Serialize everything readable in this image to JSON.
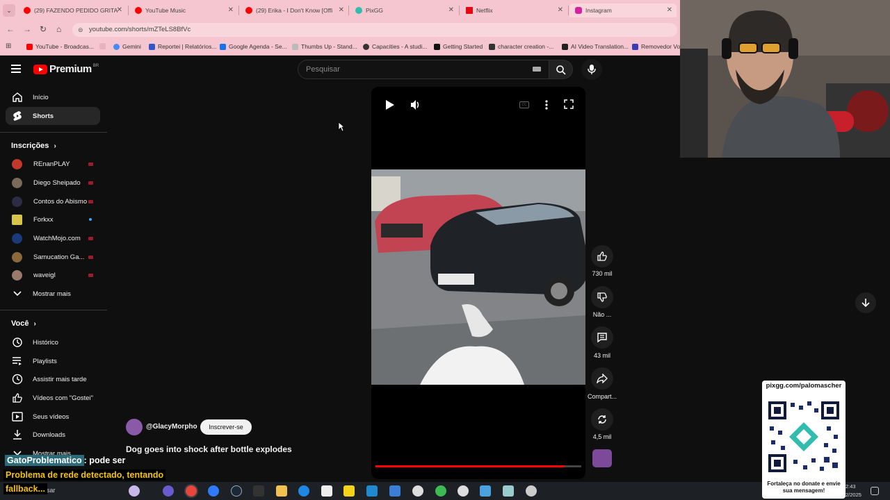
{
  "browser": {
    "tabs": [
      {
        "label": "(29) FAZENDO PEDIDO GRITA",
        "icon": "youtube-icon",
        "color": "#ff0000"
      },
      {
        "label": "YouTube Music",
        "icon": "youtube-music-icon",
        "color": "#ff0000"
      },
      {
        "label": "(29) Erika - I Don't Know [Offi",
        "icon": "youtube-icon",
        "color": "#ff0000"
      },
      {
        "label": "PixGG",
        "icon": "pixgg-icon",
        "color": "#32bcad"
      },
      {
        "label": "Netflix",
        "icon": "netflix-icon",
        "color": "#e50914"
      },
      {
        "label": "Instagram",
        "icon": "instagram-icon",
        "color": "#d6249f"
      }
    ],
    "url": "youtube.com/shorts/mZTeLS8BfVc",
    "bookmarks": [
      {
        "label": "YouTube - Broadcas...",
        "color": "#ff0000"
      },
      {
        "label": "Gemini",
        "color": "#4a8af4"
      },
      {
        "label": "Reportei | Relatórios...",
        "color": "#3355cc"
      },
      {
        "label": "Google Agenda - Se...",
        "color": "#1a73e8"
      },
      {
        "label": "Thumbs Up - Stand...",
        "color": "#999999"
      },
      {
        "label": "Capacities - A studi...",
        "color": "#333333"
      },
      {
        "label": "Getting Started",
        "color": "#111111"
      },
      {
        "label": "character creation -...",
        "color": "#333333"
      },
      {
        "label": "AI Video Translation...",
        "color": "#222222"
      },
      {
        "label": "Removedor Voc",
        "color": "#3b3bb8"
      }
    ]
  },
  "youtube": {
    "logo_text": "Premium",
    "logo_region": "BR",
    "search_placeholder": "Pesquisar",
    "sidebar": {
      "main": [
        {
          "label": "Início",
          "icon": "home-icon"
        },
        {
          "label": "Shorts",
          "icon": "shorts-icon"
        }
      ],
      "subs_title": "Inscrições",
      "subs": [
        {
          "label": "REnanPLAY",
          "color": "#c0392b"
        },
        {
          "label": "Diego Sheipado",
          "color": "#7a6a5a"
        },
        {
          "label": "Contos do Abismo",
          "color": "#2c2c44"
        },
        {
          "label": "Forkxx",
          "color": "#d9c44a"
        },
        {
          "label": "WatchMojo.com",
          "color": "#1a3a7a"
        },
        {
          "label": "Samucation Ga...",
          "color": "#8a6a3a"
        },
        {
          "label": "waveigl",
          "color": "#9a7a6a"
        }
      ],
      "show_more": "Mostrar mais",
      "you_title": "Você",
      "you": [
        {
          "label": "Histórico",
          "icon": "history-icon"
        },
        {
          "label": "Playlists",
          "icon": "playlists-icon"
        },
        {
          "label": "Assistir mais tarde",
          "icon": "watch-later-icon"
        },
        {
          "label": "Vídeos com \"Gostei\"",
          "icon": "like-icon"
        },
        {
          "label": "Seus vídeos",
          "icon": "your-videos-icon"
        },
        {
          "label": "Downloads",
          "icon": "download-icon"
        },
        {
          "label": "Mostrar mais",
          "icon": "chevron-down-icon"
        }
      ]
    },
    "short": {
      "channel": "@GlacyMorpho",
      "subscribe": "Inscrever-se",
      "title": "Dog goes into shock after bottle explodes",
      "progress": 0.92,
      "likes": "730 mil",
      "dislike": "Não ...",
      "comments": "43 mil",
      "share": "Compart...",
      "remix": "4,5 mil"
    }
  },
  "overlay": {
    "chat_user": "GatoProblematico",
    "chat_msg": ": pode ser",
    "net_warning_1": "Problema de rede detectado, tentando",
    "net_warning_2": "fallback...",
    "pix_url": "pixgg.com/palomascher",
    "pix_msg": "Fortaleça no donate e envie sua mensagem!",
    "taskbar_search": "uisar",
    "clock_time": "2:43",
    "clock_date": "2/2025"
  }
}
